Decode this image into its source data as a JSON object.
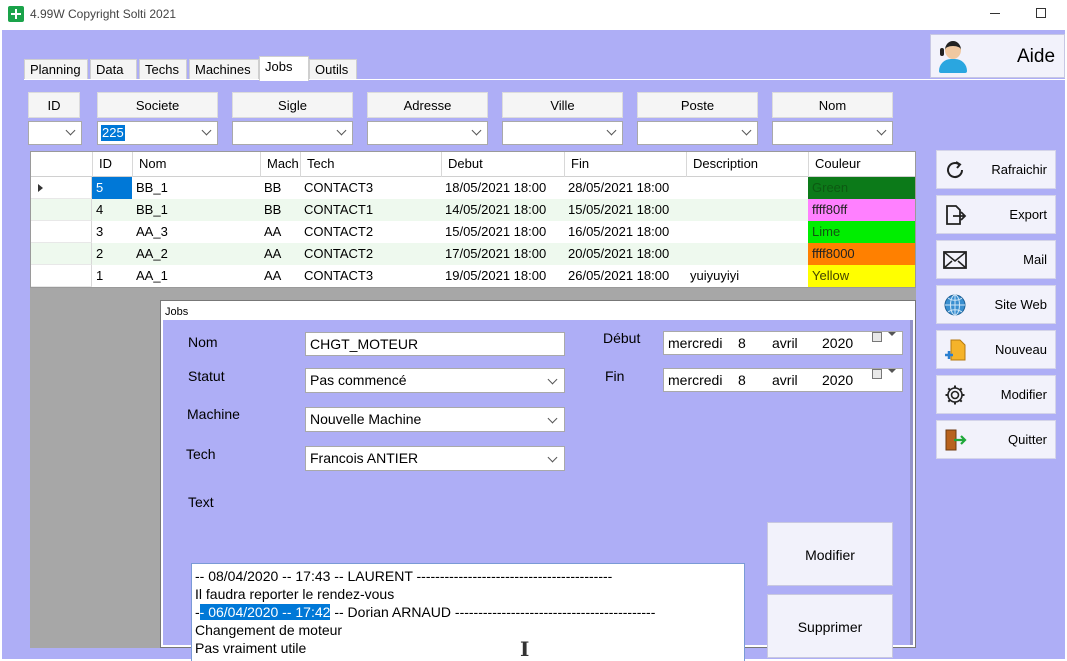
{
  "window": {
    "title": "4.99W Copyright Solti 2021"
  },
  "help": {
    "label": "Aide",
    "icon": "support-agent-icon"
  },
  "tabs": [
    {
      "label": "Planning",
      "active": false
    },
    {
      "label": "Data",
      "active": false
    },
    {
      "label": "Techs",
      "active": false
    },
    {
      "label": "Machines",
      "active": false
    },
    {
      "label": "Jobs",
      "active": true
    },
    {
      "label": "Outils",
      "active": false
    }
  ],
  "filters": {
    "labels": [
      "ID",
      "Societe",
      "Sigle",
      "Adresse",
      "Ville",
      "Poste",
      "Nom"
    ],
    "values": [
      "",
      "225",
      "",
      "",
      "",
      "",
      ""
    ]
  },
  "grid": {
    "columns": [
      "ID",
      "Nom",
      "Mach",
      "Tech",
      "Debut",
      "Fin",
      "Description",
      "Couleur"
    ],
    "rows": [
      {
        "id": "5",
        "nom": "BB_1",
        "mach": "BB",
        "tech": "CONTACT3",
        "debut": "18/05/2021 18:00",
        "fin": "28/05/2021 18:00",
        "description": "",
        "couleur": "Green",
        "couleur_hex": "#0c7a19",
        "couleur_text": "#0c5a12"
      },
      {
        "id": "4",
        "nom": "BB_1",
        "mach": "BB",
        "tech": "CONTACT1",
        "debut": "14/05/2021 18:00",
        "fin": "15/05/2021 18:00",
        "description": "",
        "couleur": "ffff80ff",
        "couleur_hex": "#ff80ff",
        "couleur_text": "#222222"
      },
      {
        "id": "3",
        "nom": "AA_3",
        "mach": "AA",
        "tech": "CONTACT2",
        "debut": "15/05/2021 18:00",
        "fin": "16/05/2021 18:00",
        "description": "",
        "couleur": "Lime",
        "couleur_hex": "#00ee00",
        "couleur_text": "#115511"
      },
      {
        "id": "2",
        "nom": "AA_2",
        "mach": "AA",
        "tech": "CONTACT2",
        "debut": "17/05/2021 18:00",
        "fin": "20/05/2021 18:00",
        "description": "",
        "couleur": "ffff8000",
        "couleur_hex": "#ff8000",
        "couleur_text": "#222222"
      },
      {
        "id": "1",
        "nom": "AA_1",
        "mach": "AA",
        "tech": "CONTACT3",
        "debut": "19/05/2021 18:00",
        "fin": "26/05/2021 18:00",
        "description": "yuiyuyiyi",
        "couleur": "Yellow",
        "couleur_hex": "#ffff00",
        "couleur_text": "#444400"
      }
    ]
  },
  "sidebar": [
    {
      "label": "Rafraichir",
      "icon": "refresh-icon"
    },
    {
      "label": "Export",
      "icon": "export-icon"
    },
    {
      "label": "Mail",
      "icon": "mail-icon"
    },
    {
      "label": "Site Web",
      "icon": "globe-icon"
    },
    {
      "label": "Nouveau",
      "icon": "new-document-icon"
    },
    {
      "label": "Modifier",
      "icon": "gear-icon"
    },
    {
      "label": "Quitter",
      "icon": "exit-door-icon"
    }
  ],
  "dialog": {
    "title": "Jobs",
    "nom_label": "Nom",
    "nom_value": "CHGT_MOTEUR",
    "statut_label": "Statut",
    "statut_value": "Pas commencé",
    "machine_label": "Machine",
    "machine_value": "Nouvelle Machine",
    "tech_label": "Tech",
    "tech_value": "Francois ANTIER",
    "debut_label": "Début",
    "debut": {
      "day_name": "mercredi",
      "day": "8",
      "month": "avril",
      "year": "2020"
    },
    "fin_label": "Fin",
    "fin": {
      "day_name": "mercredi",
      "day": "8",
      "month": "avril",
      "year": "2020"
    },
    "text_label": "Text",
    "text": {
      "line1": "-- 08/04/2020 -- 17:43 -- LAURENT  ------------------------------------------",
      "line2": "Il faudra reporter le rendez-vous",
      "line3_prefix": "-",
      "line3_selected": "- 06/04/2020 -- 17:42",
      "line3_suffix": " -- Dorian ARNAUD  -------------------------------------------",
      "line4": "Changement de moteur",
      "line5": "Pas vraiment utile"
    },
    "modifier_label": "Modifier",
    "supprimer_label": "Supprimer"
  }
}
